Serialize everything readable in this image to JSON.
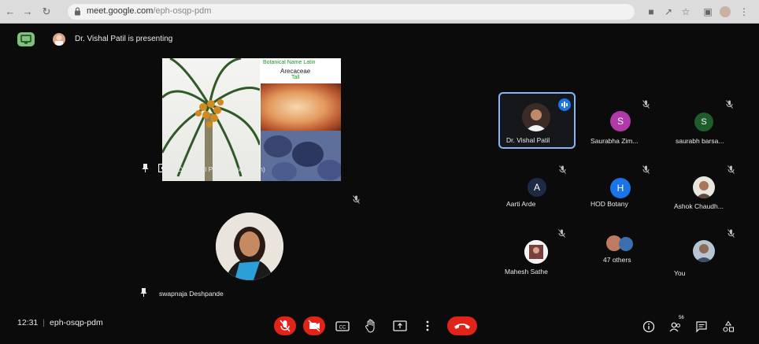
{
  "browser": {
    "url_host": "meet.google.com",
    "url_path": "/eph-osqp-pdm"
  },
  "meeting": {
    "presenting_text": "Dr. Vishal Patil is presenting",
    "time": "12:31",
    "code": "eph-osqp-pdm"
  },
  "presentation": {
    "label": "Dr. Vishal Patil (Presentation)",
    "slide_title_line1": "Botanical Name Latin",
    "slide_title_line2": "Arecaceae",
    "slide_title_line3": "Tall"
  },
  "spotlight": {
    "name": "swapnaja Deshpande"
  },
  "participants": [
    {
      "name": "Dr. Vishal Patil",
      "initial": "",
      "color": "#ffffff",
      "speaking": true
    },
    {
      "name": "Saurabha Zim...",
      "initial": "S",
      "color": "#b13aa8",
      "speaking": false
    },
    {
      "name": "saurabh barsa...",
      "initial": "S",
      "color": "#1f5c2b",
      "speaking": false
    },
    {
      "name": "Aarti Arde",
      "initial": "A",
      "color": "#1d2a44",
      "speaking": false
    },
    {
      "name": "HOD Botany",
      "initial": "H",
      "color": "#1a73e8",
      "speaking": false
    },
    {
      "name": "Ashok Chaudh...",
      "initial": "",
      "color": "#ffffff",
      "speaking": false
    },
    {
      "name": "Mahesh Sathe",
      "initial": "",
      "color": "#ffffff",
      "speaking": false
    },
    {
      "name": "47 others",
      "initial": "",
      "color": "#ffffff",
      "speaking": false
    },
    {
      "name": "You",
      "initial": "",
      "color": "#ffffff",
      "speaking": false
    }
  ],
  "people_count": "56",
  "colors": {
    "end_call": "#e2231a",
    "mic_off": "#e2231a",
    "active_border": "#8ab4f8",
    "present_badge": "#7cc27c"
  }
}
